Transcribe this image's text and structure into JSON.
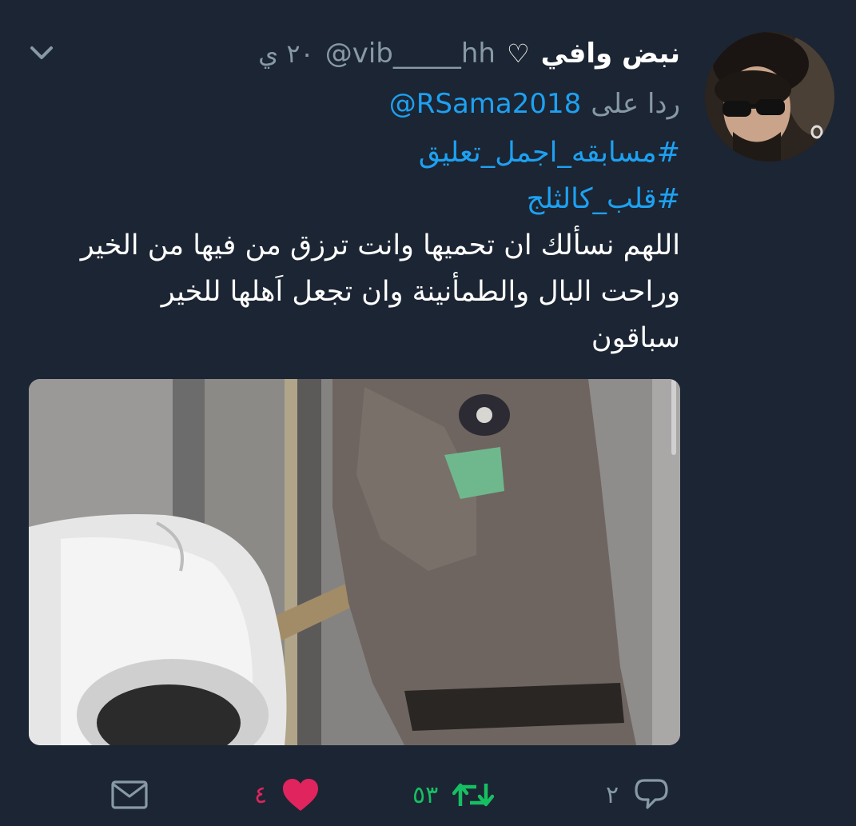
{
  "tweet": {
    "author": {
      "display_name": "نبض وافي",
      "heart": "♡",
      "handle": "@vib_____hh",
      "timestamp": "٢٠ ي"
    },
    "reply_prefix": "ردا على",
    "reply_to": "@RSama2018",
    "hashtags": [
      "#مسابقه_اجمل_تعليق",
      "#قلب_كالثلج"
    ],
    "body_lines": [
      "اللهم نسألك ان تحميها وانت ترزق من فيها من الخير",
      "وراحت البال والطمأنينة وان تجعل اَهلها للخير",
      "سباقون"
    ],
    "actions": {
      "reply_count": "٢",
      "retweet_count": "٥٣",
      "like_count": "٤"
    }
  },
  "colors": {
    "background": "#1c2533",
    "link": "#1da1f2",
    "muted": "#8899a6",
    "retweet_active": "#17bf63",
    "like_active": "#e0245e"
  },
  "icons": [
    "chevron-down-icon",
    "reply-icon",
    "retweet-icon",
    "heart-icon",
    "mail-icon"
  ]
}
